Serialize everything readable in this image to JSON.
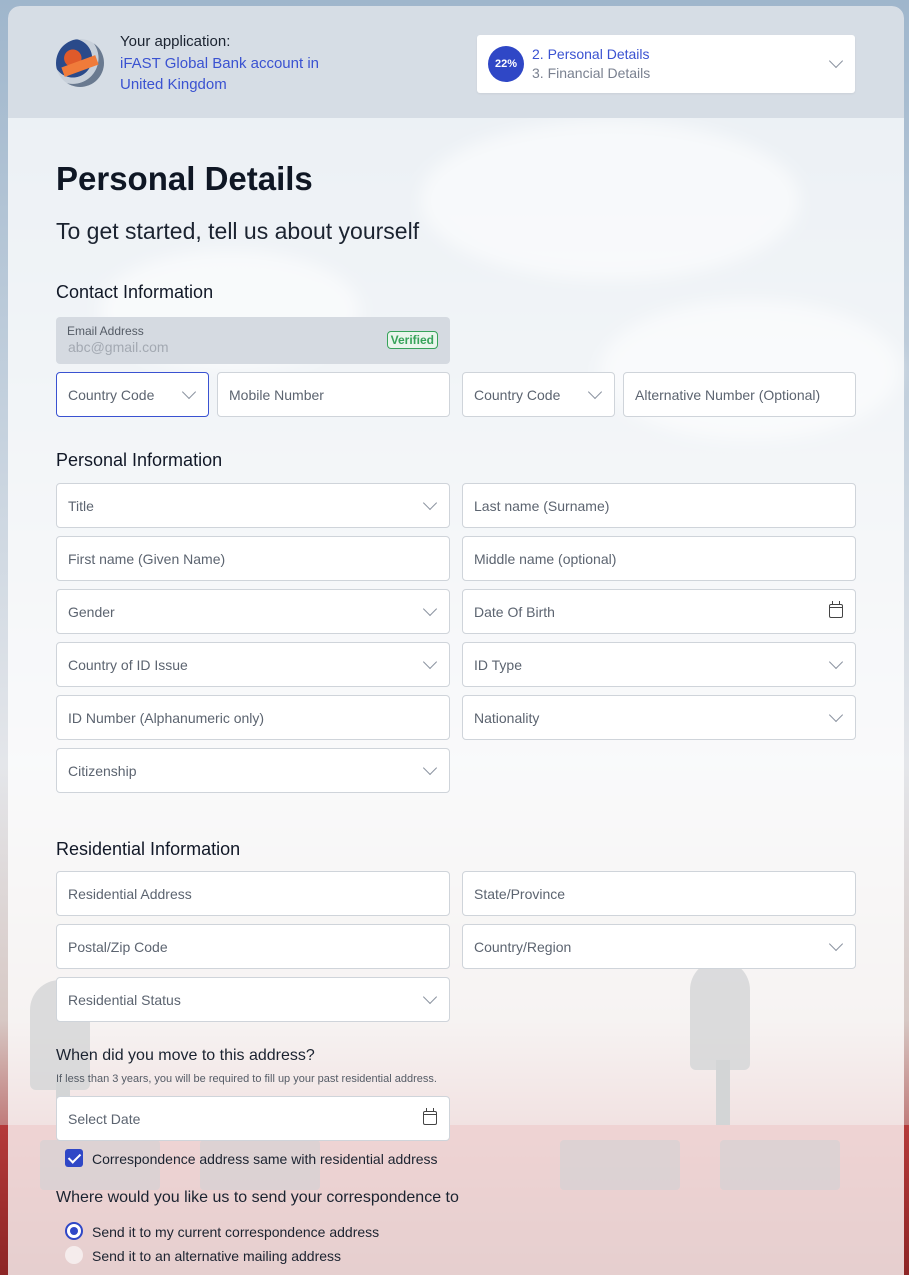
{
  "header": {
    "app_label": "Your application:",
    "app_name": "iFAST Global Bank account in United Kingdom",
    "progress_percent": "22%",
    "current_step": "2. Personal Details",
    "next_step": "3. Financial Details"
  },
  "page": {
    "title": "Personal Details",
    "subtitle": "To get started, tell us about yourself"
  },
  "contact": {
    "section_title": "Contact Information",
    "email_label": "Email Address",
    "email_value": "abc@gmail.com",
    "verified_badge": "Verified",
    "country_code_1": "Country Code",
    "mobile_number": "Mobile Number",
    "country_code_2": "Country Code",
    "alternative_number": "Alternative Number (Optional)"
  },
  "personal": {
    "section_title": "Personal Information",
    "title": "Title",
    "last_name": "Last name (Surname)",
    "first_name": "First name (Given Name)",
    "middle_name": "Middle name (optional)",
    "gender": "Gender",
    "dob": "Date Of Birth",
    "country_id_issue": "Country of ID Issue",
    "id_type": "ID Type",
    "id_number": "ID Number (Alphanumeric only)",
    "nationality": "Nationality",
    "citizenship": "Citizenship"
  },
  "residential": {
    "section_title": "Residential Information",
    "address": "Residential Address",
    "state": "State/Province",
    "postal": "Postal/Zip Code",
    "country_region": "Country/Region",
    "status": "Residential Status",
    "move_question": "When did you move to this address?",
    "move_note": "If less than 3 years, you will be required to fill up your past residential address.",
    "select_date": "Select Date",
    "same_address_label": "Correspondence address same with residential address"
  },
  "correspondence": {
    "question": "Where would you like us to send your correspondence to",
    "option_current": "Send it to my current correspondence address",
    "option_alternative": "Send it to an alternative mailing address"
  },
  "colors": {
    "accent": "#2f47c6",
    "link": "#3a52d1",
    "verified": "#37a35a"
  },
  "icons": [
    "chevron-down-icon",
    "calendar-icon",
    "checkmark-icon"
  ]
}
